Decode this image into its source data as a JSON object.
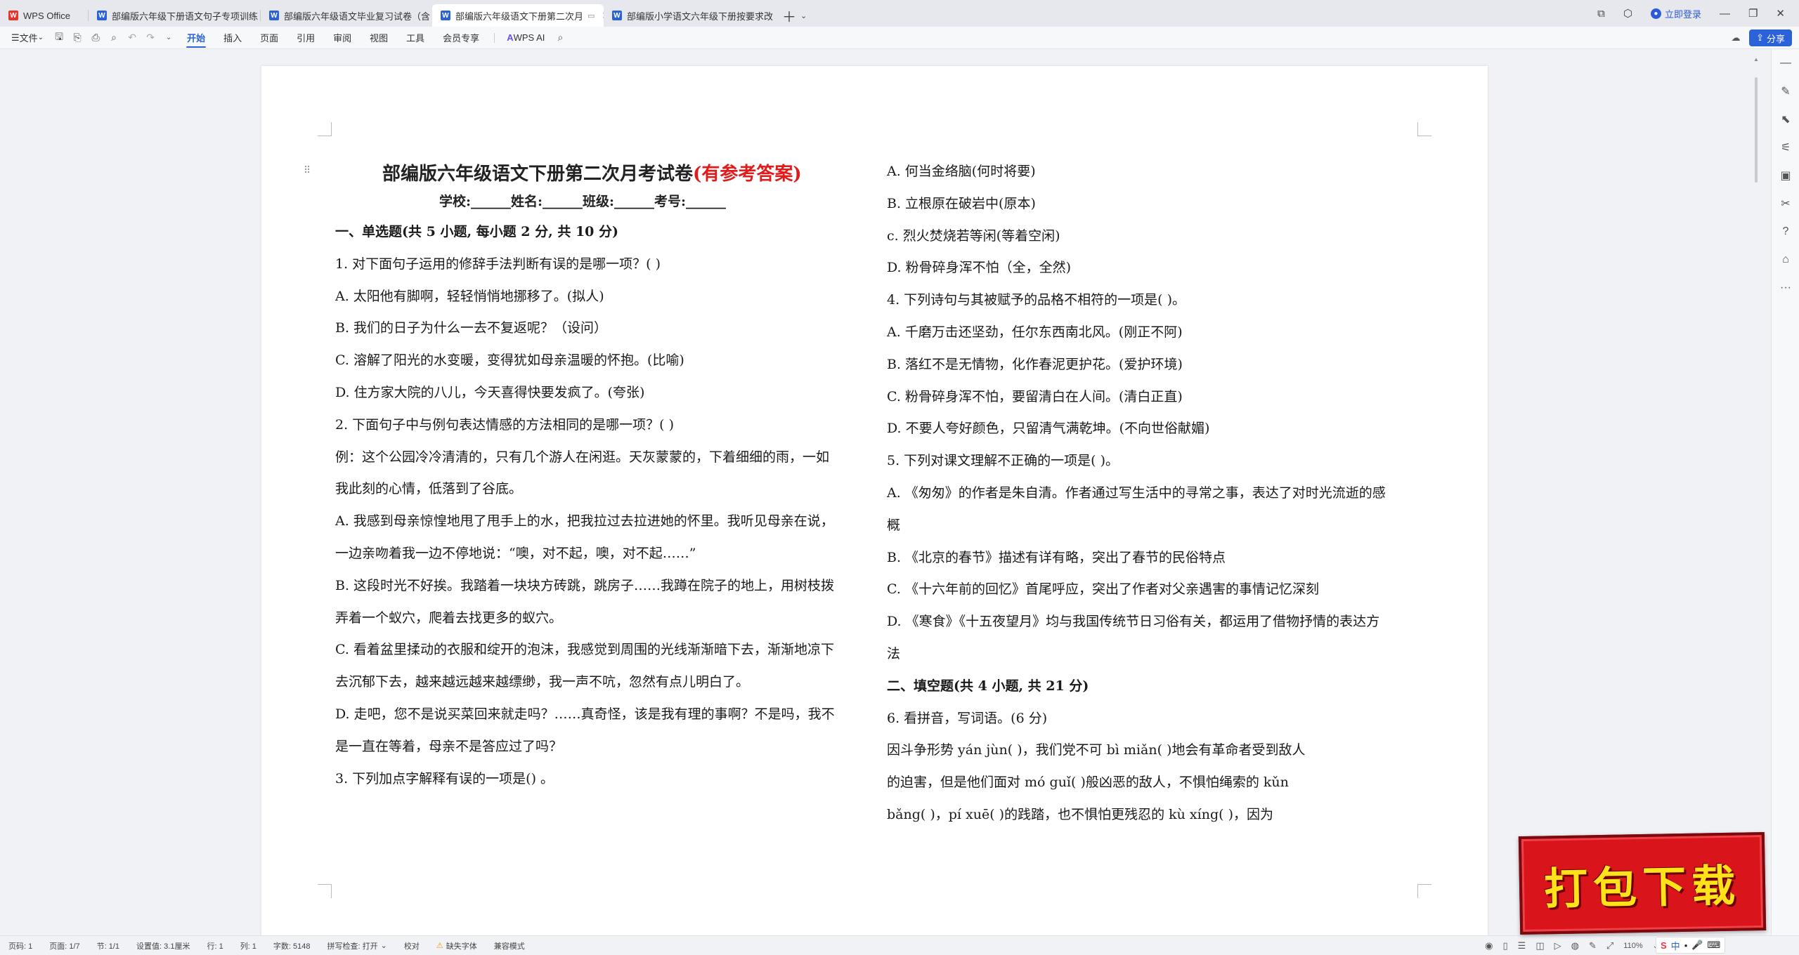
{
  "tabs": [
    {
      "label": "WPS Office",
      "type": "home"
    },
    {
      "label": "部编版六年级下册语文句子专项训练",
      "type": "doc"
    },
    {
      "label": "部编版六年级语文毕业复习试卷（含",
      "type": "doc"
    },
    {
      "label": "部编版六年级语文下册第二次月",
      "type": "doc",
      "active": true
    },
    {
      "label": "部编版小学语文六年级下册按要求改",
      "type": "doc"
    }
  ],
  "window": {
    "login_label": "立即登录",
    "share_label": "分享"
  },
  "toolbar": {
    "file_label": "文件",
    "menus": [
      "开始",
      "插入",
      "页面",
      "引用",
      "审阅",
      "视图",
      "工具",
      "会员专享"
    ],
    "active_menu": "开始",
    "ai_label": "WPS AI"
  },
  "document": {
    "title_main": "部编版六年级语文下册第二次月考试卷",
    "title_suffix": "(有参考答案)",
    "info_line": "学校:______姓名:______班级:______考号:______",
    "left_lines": [
      {
        "t": "一、单选题(共 5 小题, 每小题 2 分, 共 10 分)",
        "b": true
      },
      {
        "t": "1. 对下面句子运用的修辞手法判断有误的是哪一项？(        )"
      },
      {
        "t": "A. 太阳他有脚啊，轻轻悄悄地挪移了。(拟人)"
      },
      {
        "t": "B. 我们的日子为什么一去不复返呢？（设问）"
      },
      {
        "t": "C. 溶解了阳光的水变暖，变得犹如母亲温暖的怀抱。(比喻)"
      },
      {
        "t": "D. 住方家大院的八儿，今天喜得快要发疯了。(夸张)"
      },
      {
        "t": "2. 下面句子中与例句表达情感的方法相同的是哪一项？(          )"
      },
      {
        "t": "例：这个公园冷冷清清的，只有几个游人在闲逛。天灰蒙蒙的，下着细细的雨，一如"
      },
      {
        "t": "我此刻的心情，低落到了谷底。"
      },
      {
        "t": "A. 我感到母亲惊惶地甩了甩手上的水，把我拉过去拉进她的怀里。我听见母亲在说，"
      },
      {
        "t": "一边亲吻着我一边不停地说：“噢，对不起，噢，对不起……”"
      },
      {
        "t": "B. 这段时光不好挨。我踏着一块块方砖跳，跳房子……我蹲在院子的地上，用树枝拨"
      },
      {
        "t": "弄着一个蚁穴，爬着去找更多的蚁穴。"
      },
      {
        "t": "C. 看着盆里揉动的衣服和绽开的泡沫，我感觉到周围的光线渐渐暗下去，渐渐地凉下"
      },
      {
        "t": "去沉郁下去，越来越远越来越缥缈，我一声不吭，忽然有点儿明白了。"
      },
      {
        "t": "D. 走吧，您不是说买菜回来就走吗？……真奇怪，该是我有理的事啊？不是吗，我不"
      },
      {
        "t": "是一直在等着，母亲不是答应过了吗？"
      },
      {
        "t": "3. 下列加点字解释有误的一项是() 。"
      }
    ],
    "right_lines": [
      {
        "t": "A. 何当金络脑(何时将要)"
      },
      {
        "t": "B. 立根原在破岩中(原本)"
      },
      {
        "t": "c. 烈火焚烧若等闲(等着空闲)"
      },
      {
        "t": "D. 粉骨碎身浑不怕（全，全然)"
      },
      {
        "t": "4. 下列诗句与其被赋予的品格不相符的一项是(          )。"
      },
      {
        "t": "A. 千磨万击还坚劲，任尔东西南北风。(刚正不阿)"
      },
      {
        "t": "B. 落红不是无情物，化作春泥更护花。(爱护环境)"
      },
      {
        "t": "C. 粉骨碎身浑不怕，要留清白在人间。(清白正直)"
      },
      {
        "t": "D. 不要人夸好颜色，只留清气满乾坤。(不向世俗献媚)"
      },
      {
        "t": "5. 下列对课文理解不正确的一项是(          )。"
      },
      {
        "t": "A. 《匆匆》的作者是朱自清。作者通过写生活中的寻常之事，表达了对时光流逝的感"
      },
      {
        "t": "概"
      },
      {
        "t": "B. 《北京的春节》描述有详有略，突出了春节的民俗特点"
      },
      {
        "t": "C. 《十六年前的回忆》首尾呼应，突出了作者对父亲遇害的事情记忆深刻"
      },
      {
        "t": "D. 《寒食》《十五夜望月》均与我国传统节日习俗有关，都运用了借物抒情的表达方"
      },
      {
        "t": "法"
      },
      {
        "t": "二、填空题(共 4 小题, 共 21 分)",
        "b": true
      },
      {
        "t": "6. 看拼音，写词语。(6 分)"
      },
      {
        "t": "因斗争形势 yán  jùn(          )，我们党不可 bì  miǎn(          )地会有革命者受到敌人"
      },
      {
        "t": "的迫害，但是他们面对 mó  guǐ(          )般凶恶的敌人，不惧怕绳索的 kǔn"
      },
      {
        "t": "bǎng(          )，pí  xuē(          )的践踏，也不惧怕更残忍的 kù  xíng(          )，因为"
      }
    ]
  },
  "status": {
    "page": "页码: 1",
    "pages": "页面: 1/7",
    "section": "节: 1/1",
    "setting": "设置值: 3.1厘米",
    "row": "行: 1",
    "col": "列: 1",
    "words": "字数: 5148",
    "spell": "拼写检查: 打开",
    "proof": "校对",
    "missing_font": "缺失字体",
    "compat": "兼容模式",
    "zoom": "110%"
  },
  "banner_text": "打包下载",
  "ime": {
    "lang": "中"
  },
  "colors": {
    "accent": "#2b62d9",
    "title_red": "#e01b1b",
    "banner_red": "#d9141b",
    "banner_text": "#ffe21a"
  }
}
